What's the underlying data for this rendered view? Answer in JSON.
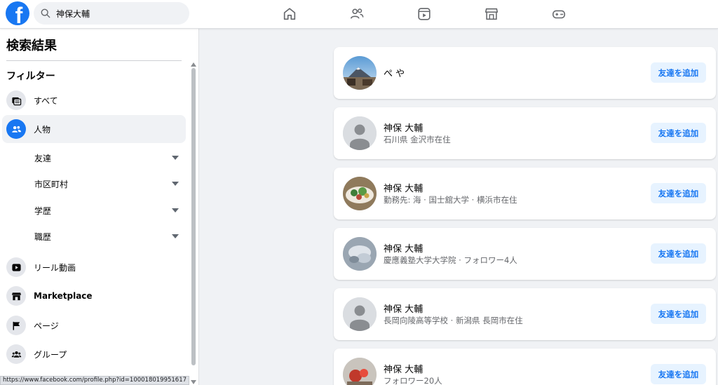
{
  "brand": {
    "logo_letter": "f",
    "color": "#1877f2"
  },
  "search": {
    "value": "神保大輔",
    "icon": "search-icon"
  },
  "nav": [
    {
      "name": "home-icon"
    },
    {
      "name": "friends-icon"
    },
    {
      "name": "video-icon"
    },
    {
      "name": "marketplace-icon"
    },
    {
      "name": "gaming-icon"
    }
  ],
  "sidebar": {
    "title": "検索結果",
    "filter_heading": "フィルター",
    "items": [
      {
        "label": "すべて",
        "icon": "all-results-icon"
      },
      {
        "label": "人物",
        "icon": "people-icon"
      },
      {
        "label": "リール動画",
        "icon": "reels-icon"
      },
      {
        "label": "Marketplace",
        "icon": "marketplace-icon"
      },
      {
        "label": "ページ",
        "icon": "flag-icon"
      },
      {
        "label": "グループ",
        "icon": "groups-icon"
      }
    ],
    "sub_filters": [
      {
        "label": "友達"
      },
      {
        "label": "市区町村"
      },
      {
        "label": "学歴"
      },
      {
        "label": "職歴"
      }
    ]
  },
  "status_url": "https://www.facebook.com/profile.php?id=100018019951617",
  "results": [
    {
      "name": "ぺ や",
      "detail": "",
      "button": "友達を追加",
      "avatar": "photo-avatar-landscape"
    },
    {
      "name": "神保 大輔",
      "detail": "石川県 金沢市在住",
      "button": "友達を追加",
      "avatar": "default-avatar"
    },
    {
      "name": "神保 大輔",
      "detail": "勤務先: 海 · 国士舘大学 · 横浜市在住",
      "button": "友達を追加",
      "avatar": "photo-avatar-food"
    },
    {
      "name": "神保 大輔",
      "detail": "慶應義塾大学大学院 · フォロワー4人",
      "button": "友達を追加",
      "avatar": "photo-avatar-blurry"
    },
    {
      "name": "神保 大輔",
      "detail": "長岡向陵高等学校 · 新潟県 長岡市在住",
      "button": "友達を追加",
      "avatar": "default-avatar"
    },
    {
      "name": "神保 大輔",
      "detail": "フォロワー20人",
      "button": "友達を追加",
      "avatar": "photo-avatar-red"
    }
  ]
}
